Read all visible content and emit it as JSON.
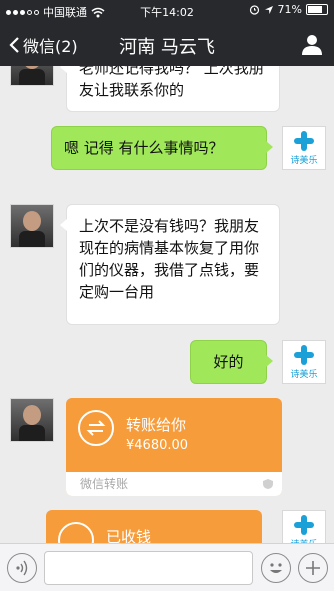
{
  "status_bar": {
    "carrier": "中国联通",
    "time": "下午14:02",
    "battery": "71%",
    "battery_level": 0.71
  },
  "nav": {
    "back_label": "微信(2)",
    "title": "河南 马云飞"
  },
  "messages": [
    {
      "side": "in",
      "text": "老师还记得我吗？ 上次我朋友让我联系你的"
    },
    {
      "side": "out",
      "text": "嗯  记得  有什么事情吗？"
    },
    {
      "side": "in",
      "text": "上次不是没有钱吗？我朋友现在的病情基本恢复了用你们的仪器，我借了点钱，要定购一台用"
    },
    {
      "side": "out",
      "text": "好的"
    },
    {
      "side": "in",
      "type": "transfer",
      "title": "转账给你",
      "amount": "¥4680.00",
      "footer": "微信转账"
    },
    {
      "side": "out",
      "type": "transfer",
      "title": "已收钱"
    }
  ],
  "logo_text": "诗美乐",
  "icons": {
    "back": "chevron-left-icon",
    "profile": "person-icon",
    "voice": "voice-icon",
    "emoji": "smiley-icon",
    "add": "plus-icon"
  },
  "colors": {
    "bar": "#27292d",
    "chat_bg": "#ececec",
    "out_bubble": "#a0e75a",
    "transfer": "#f79c3a",
    "logo": "#1ba1d8"
  }
}
